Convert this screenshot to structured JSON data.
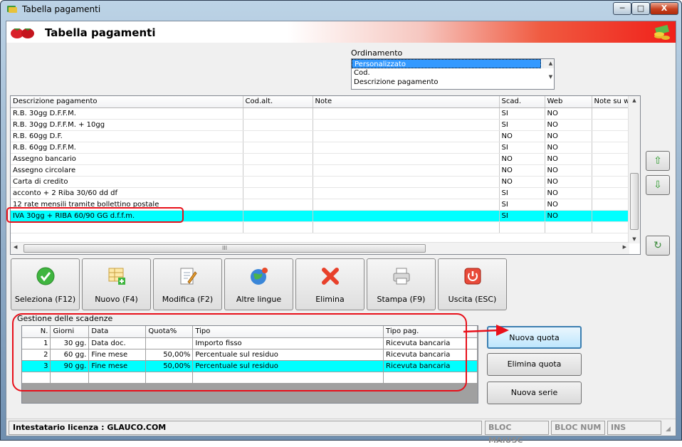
{
  "window": {
    "title": "Tabella pagamenti",
    "min_label": "─",
    "max_label": "□",
    "close_label": "X"
  },
  "header": {
    "title": "Tabella pagamenti"
  },
  "ordinamento": {
    "label": "Ordinamento",
    "options": [
      "Personalizzato",
      "Cod.",
      "Descrizione pagamento"
    ],
    "selected": "Personalizzato"
  },
  "grid": {
    "columns": [
      "Descrizione pagamento",
      "Cod.alt.",
      "Note",
      "Scad.",
      "Web",
      "Note su w"
    ],
    "rows": [
      {
        "desc": "R.B. 30gg D.F.F.M.",
        "cod": "",
        "note": "",
        "scad": "SI",
        "web": "NO",
        "notew": ""
      },
      {
        "desc": "R.B. 30gg D.F.F.M. + 10gg",
        "cod": "",
        "note": "",
        "scad": "SI",
        "web": "NO",
        "notew": ""
      },
      {
        "desc": "R.B. 60gg D.F.",
        "cod": "",
        "note": "",
        "scad": "NO",
        "web": "NO",
        "notew": ""
      },
      {
        "desc": "R.B. 60gg D.F.F.M.",
        "cod": "",
        "note": "",
        "scad": "SI",
        "web": "NO",
        "notew": ""
      },
      {
        "desc": "Assegno bancario",
        "cod": "",
        "note": "",
        "scad": "NO",
        "web": "NO",
        "notew": ""
      },
      {
        "desc": "Assegno circolare",
        "cod": "",
        "note": "",
        "scad": "NO",
        "web": "NO",
        "notew": ""
      },
      {
        "desc": "Carta di credito",
        "cod": "",
        "note": "",
        "scad": "NO",
        "web": "NO",
        "notew": ""
      },
      {
        "desc": "acconto + 2 Riba 30/60 dd df",
        "cod": "",
        "note": "",
        "scad": "SI",
        "web": "NO",
        "notew": ""
      },
      {
        "desc": "12 rate mensili tramite bollettino postale",
        "cod": "",
        "note": "",
        "scad": "SI",
        "web": "NO",
        "notew": ""
      },
      {
        "desc": "IVA 30gg + RIBA 60/90 GG d.f.f.m.",
        "cod": "",
        "note": "",
        "scad": "SI",
        "web": "NO",
        "notew": ""
      },
      {
        "desc": "",
        "cod": "",
        "note": "",
        "scad": "",
        "web": "",
        "notew": ""
      }
    ],
    "scroll_grip": "III"
  },
  "side_buttons": {
    "up": "⇧",
    "down": "⇩",
    "refresh": "↻"
  },
  "toolbar": {
    "seleziona": "Seleziona (F12)",
    "nuovo": "Nuovo (F4)",
    "modifica": "Modifica (F2)",
    "lingue": "Altre lingue",
    "elimina": "Elimina",
    "stampa": "Stampa (F9)",
    "uscita": "Uscita (ESC)"
  },
  "scadenze": {
    "label": "Gestione delle scadenze",
    "columns": [
      "N.",
      "Giorni",
      "Data",
      "Quota%",
      "Tipo",
      "Tipo pag."
    ],
    "rows": [
      {
        "n": "1",
        "giorni": "30 gg.",
        "data": "Data doc.",
        "quota": "",
        "tipo": "Importo fisso",
        "tipopag": "Ricevuta bancaria"
      },
      {
        "n": "2",
        "giorni": "60 gg.",
        "data": "Fine mese",
        "quota": "50,00%",
        "tipo": "Percentuale sul residuo",
        "tipopag": "Ricevuta bancaria"
      },
      {
        "n": "3",
        "giorni": "90 gg.",
        "data": "Fine mese",
        "quota": "50,00%",
        "tipo": "Percentuale sul residuo",
        "tipopag": "Ricevuta bancaria"
      },
      {
        "n": "",
        "giorni": "",
        "data": "",
        "quota": "",
        "tipo": "",
        "tipopag": ""
      }
    ]
  },
  "quota_buttons": {
    "nuova": "Nuova quota",
    "elimina": "Elimina quota",
    "serie": "Nuova serie"
  },
  "status": {
    "licenza": "Intestatario licenza : GLAUCO.COM",
    "maiusc": "BLOC MAIUSC",
    "num": "BLOC NUM",
    "ins": "INS"
  },
  "colors": {
    "highlight": "#00ffff",
    "annotation": "#e8101a",
    "header_gradient_end": "#f0201a"
  }
}
